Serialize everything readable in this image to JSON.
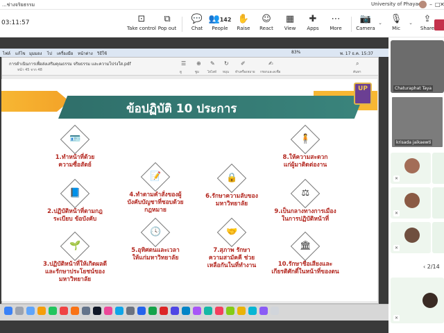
{
  "window": {
    "meeting_title": "...ช่างจริยธรรม",
    "org": "University of Phayao",
    "controls": [
      "–",
      "□",
      "✕"
    ]
  },
  "toolbar": {
    "timer": "03:11:57",
    "buttons": [
      {
        "label": "Take control",
        "icon": "take-control-icon"
      },
      {
        "label": "Pop out",
        "icon": "pop-out-icon"
      },
      {
        "label": "Chat",
        "icon": "chat-icon"
      },
      {
        "label": "People",
        "icon": "people-icon",
        "count": "142"
      },
      {
        "label": "Raise",
        "icon": "raise-hand-icon"
      },
      {
        "label": "React",
        "icon": "react-icon"
      },
      {
        "label": "View",
        "icon": "view-icon"
      },
      {
        "label": "Apps",
        "icon": "apps-icon"
      },
      {
        "label": "More",
        "icon": "more-icon"
      },
      {
        "label": "Camera",
        "icon": "camera-off-icon"
      },
      {
        "label": "Mic",
        "icon": "mic-off-icon"
      },
      {
        "label": "Share",
        "icon": "share-icon"
      }
    ]
  },
  "shared_screen": {
    "menubar_items": [
      "ไฟล์",
      "แก้ไข",
      "มุมมอง",
      "ไป",
      "เครื่องมือ",
      "หน้าต่าง",
      "วิธีใช้"
    ],
    "menubar_status": [
      "83%",
      "พ. 17 ธ.ค. 15:37"
    ],
    "pdf": {
      "doc_name": "การดำเนินการเพื่อส่งเสริมคุณธรรม จริยธรรม และความโปร่งใส.pdf",
      "pages": "หน้า 45 จาก 48",
      "tools": [
        "ดู",
        "ซูม",
        "ไฮไลท์",
        "หมุน",
        "ทำเครื่องหมาย",
        "กรอกและลงชื่อ",
        "ค้นหา"
      ]
    },
    "slide": {
      "title": "ข้อปฏิบัติ 10 ประการ",
      "logo_text": "UP",
      "items": [
        {
          "icon": "person-card-icon",
          "label": "1.ทำหน้าที่ด้วย\nความซื่อสัตย์"
        },
        {
          "icon": "rulebook-icon",
          "label": "2.ปฏิบัติหน้าที่ตามกฎ\nระเบียบ ข้อบังคับ"
        },
        {
          "icon": "growth-icon",
          "label": "3.ปฏิบัติหน้าที่ให้เกิดผลดี\nและรักษาประโยชน์ของ\nมหาวิทยาลัย"
        },
        {
          "icon": "command-icon",
          "label": "4.ทำตามคำสั่งของผู้\nบังคับบัญชาที่ชอบด้วย\nกฎหมาย"
        },
        {
          "icon": "clock-icon",
          "label": "5.อุทิศตนและเวลา\nให้แก่มหาวิทยาลัย"
        },
        {
          "icon": "secret-document-icon",
          "label": "6.รักษาความลับของ\nมหาวิทยาลัย"
        },
        {
          "icon": "teamwork-icon",
          "label": "7.สุภาพ รักษา\nความสามัคคี ช่วย\nเหลือกันในที่ทำงาน"
        },
        {
          "icon": "service-icon",
          "label": "8.ให้ความสะดวก\nแก่ผู้มาติดต่องาน"
        },
        {
          "icon": "neutral-icon",
          "label": "9.เป็นกลางทางการเมือง\nในการปฏิบัติหน้าที่"
        },
        {
          "icon": "reputation-icon",
          "label": "10.รักษาชื่อเสียงและ\nเกียรติศักดิ์ในหน้าที่ของตน"
        }
      ]
    }
  },
  "participants": {
    "tiles": [
      {
        "name": "Chaturaphat Taya"
      },
      {
        "name": "krisada jaikaewti"
      }
    ],
    "pager": "2/14"
  },
  "colors": {
    "title_band": "#2f6f6a",
    "accent_orange": "#f7b733",
    "label_red": "#b3261e"
  }
}
